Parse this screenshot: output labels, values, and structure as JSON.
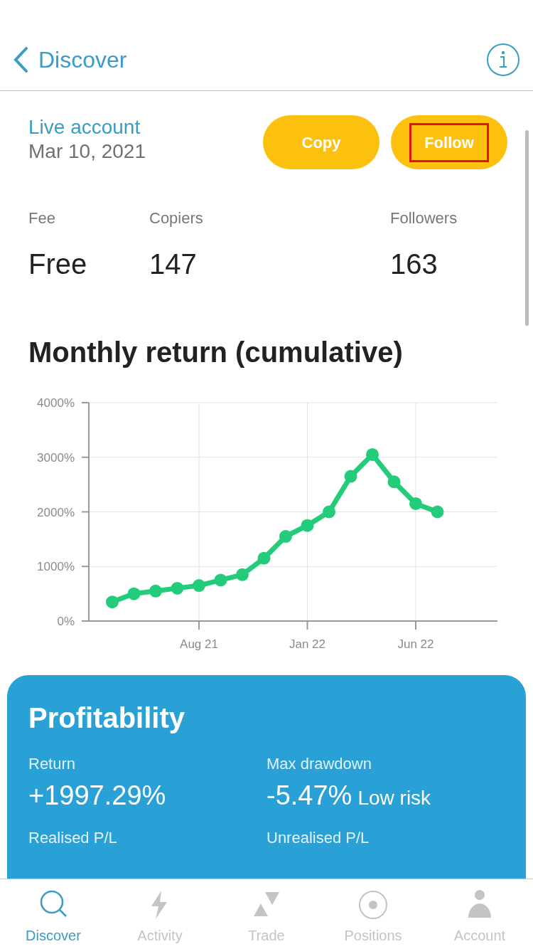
{
  "header": {
    "back_label": "Discover"
  },
  "account": {
    "type": "Live account",
    "date": "Mar 10, 2021"
  },
  "actions": [
    {
      "label": "Copy",
      "highlighted": false
    },
    {
      "label": "Follow",
      "highlighted": true
    }
  ],
  "stats": [
    {
      "label": "Fee",
      "value": "Free"
    },
    {
      "label": "Copiers",
      "value": "147"
    },
    {
      "label": "Followers",
      "value": "163"
    }
  ],
  "chart_title": "Monthly return (cumulative)",
  "chart_data": {
    "type": "line",
    "categories": [
      null,
      null,
      null,
      null,
      "Aug 21",
      null,
      null,
      null,
      null,
      "Jan 22",
      null,
      null,
      null,
      null,
      "Jun 22",
      null
    ],
    "grid": true,
    "series": [
      {
        "color": "#22cc7a",
        "marker": true,
        "values": [
          350,
          500,
          550,
          600,
          650,
          750,
          850,
          1150,
          1550,
          1750,
          2000,
          2650,
          3050,
          2550,
          2150,
          2000
        ]
      }
    ],
    "ylim": [
      0,
      4000
    ],
    "yticks": [
      {
        "value": 0,
        "label": "0%"
      },
      {
        "value": 1000,
        "label": "1000%"
      },
      {
        "value": 2000,
        "label": "2000%"
      },
      {
        "value": 3000,
        "label": "3000%"
      },
      {
        "value": 4000,
        "label": "4000%"
      }
    ]
  },
  "profitability": {
    "title": "Profitability",
    "metrics": [
      {
        "label": "Return",
        "value": "+1997.29%"
      },
      {
        "label": "Max drawdown",
        "value": "-5.47%",
        "note": "Low risk"
      },
      {
        "label": "Realised P/L"
      },
      {
        "label": "Unrealised P/L"
      }
    ]
  },
  "tabs": [
    {
      "label": "Discover",
      "kind": "search",
      "selected": true
    },
    {
      "label": "Activity",
      "kind": "bolt",
      "selected": false
    },
    {
      "label": "Trade",
      "kind": "trade",
      "selected": false
    },
    {
      "label": "Positions",
      "kind": "target",
      "selected": false
    },
    {
      "label": "Account",
      "kind": "person",
      "selected": false
    }
  ]
}
